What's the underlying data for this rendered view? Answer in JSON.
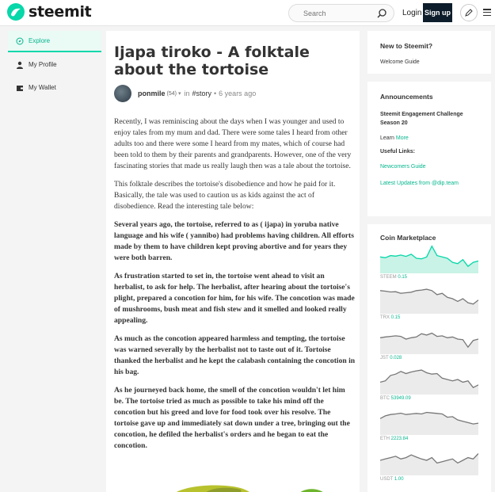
{
  "header": {
    "logo_text": "steemit",
    "search_placeholder": "Search",
    "login_label": "Login",
    "signup_label": "Sign up",
    "icons": [
      "steemit-logo-icon",
      "search-icon",
      "pencil-icon",
      "hamburger-menu-icon"
    ]
  },
  "nav": {
    "items": [
      {
        "label": "Explore",
        "icon": "compass-icon"
      },
      {
        "label": "My Profile",
        "icon": "user-icon"
      },
      {
        "label": "My Wallet",
        "icon": "wallet-icon"
      }
    ]
  },
  "post": {
    "title": "Ijapa tiroko - A folktale about the tortoise",
    "author": "ponmile",
    "reputation": "(54)",
    "in_text": "in",
    "tag": "#story",
    "dot": "•",
    "age": "6 years ago",
    "paragraphs": [
      "Recently, I was reminiscing about the days when I was younger and used to enjoy tales from my mum and dad. There were some tales I heard from other adults too and there were some I heard from my mates, which of course had been told to them by their parents and grandparents. However, one of the very fascinating stories that made us really laugh then was a tale about the tortoise.",
      "This folktale describes the tortoise's disobedience and how he paid for it. Basically, the tale was used to caution us as kids against the act of disobedience. Read the interesting tale below:",
      "Several years ago, the tortoise, referred to as ( ijapa) in yoruba native language and his wife ( yannibo) had problems having children. All efforts made by them to have children kept proving abortive and for years they were both barren.",
      "As frustration started to set in, the tortoise went ahead to visit an herbalist, to ask for help. The herbalist, after hearing about the tortoise's plight, prepared a concotion for him, for his wife. The concotion was made of mushrooms, bush meat and fish stew and it smelled and looked really appealing.",
      "As much as the concotion appeared harmless and tempting, the tortoise was warned severally by the herbalist not to taste out of it. Tortoise thanked the herbalist and he kept the calabash containing the concotion in his bag.",
      "As he journeyed back home, the smell of the concotion wouldn't let him be. The tortoise tried as much as possible to take his mind off the concotion but his greed and love for food took over his resolve. The tortoise gave up and immediately sat down under a tree, bringing out the concotion, he defiled the herbalist's orders and he began to eat the concotion."
    ]
  },
  "sidebar": {
    "new_heading": "New to Steemit?",
    "welcome_guide": "Welcome Guide",
    "announcements_heading": "Announcements",
    "engagement": "Steemit Engagement Challenge Season 20",
    "learn": "Learn",
    "more": "More",
    "useful_links": "Useful Links:",
    "newcomers": "Newcomers Guide",
    "latest": "Latest Updates from @dip.team",
    "coin_heading": "Coin Marketplace",
    "coins": [
      {
        "name": "STEEM",
        "price": "0.15",
        "values": [
          0.55,
          0.52,
          0.6,
          0.58,
          0.62,
          0.57,
          0.65,
          0.5,
          0.48,
          0.55,
          0.95,
          0.6,
          0.55,
          0.5,
          0.35,
          0.3,
          0.45,
          0.2,
          0.35,
          0.4
        ],
        "fill": "#c8f3e6",
        "line": "#07d7a9"
      },
      {
        "name": "TRX",
        "price": "0.15",
        "values": [
          0.8,
          0.78,
          0.75,
          0.76,
          0.7,
          0.72,
          0.74,
          0.8,
          0.82,
          0.85,
          0.8,
          0.65,
          0.7,
          0.55,
          0.5,
          0.4,
          0.5,
          0.35,
          0.3,
          0.45
        ],
        "fill": "#ebebeb",
        "line": "#777"
      },
      {
        "name": "JST",
        "price": "0.028",
        "values": [
          0.55,
          0.58,
          0.6,
          0.62,
          0.6,
          0.5,
          0.55,
          0.58,
          0.7,
          0.65,
          0.72,
          0.6,
          0.62,
          0.55,
          0.58,
          0.5,
          0.48,
          0.2,
          0.45,
          0.5
        ],
        "fill": "#ebebeb",
        "line": "#777"
      },
      {
        "name": "BTC",
        "price": "53949.09",
        "values": [
          0.4,
          0.45,
          0.65,
          0.7,
          0.8,
          0.72,
          0.78,
          0.82,
          0.85,
          0.75,
          0.7,
          0.72,
          0.55,
          0.5,
          0.45,
          0.5,
          0.4,
          0.45,
          0.2,
          0.3
        ],
        "fill": "#ebebeb",
        "line": "#777"
      },
      {
        "name": "ETH",
        "price": "2223.84",
        "values": [
          0.55,
          0.65,
          0.7,
          0.72,
          0.75,
          0.7,
          0.72,
          0.74,
          0.72,
          0.78,
          0.76,
          0.74,
          0.72,
          0.6,
          0.62,
          0.5,
          0.45,
          0.4,
          0.35,
          0.38
        ],
        "fill": "#ebebeb",
        "line": "#777"
      },
      {
        "name": "USDT",
        "price": "1.00",
        "values": [
          0.5,
          0.55,
          0.6,
          0.65,
          0.55,
          0.6,
          0.7,
          0.62,
          0.55,
          0.5,
          0.6,
          0.4,
          0.45,
          0.5,
          0.55,
          0.4,
          0.5,
          0.6,
          0.55,
          0.75
        ],
        "fill": "#ebebeb",
        "line": "#777"
      }
    ]
  },
  "colors": {
    "accent": "#07d7a9",
    "accent_text": "#07b68f",
    "signup_bg": "#0d1d2b"
  }
}
